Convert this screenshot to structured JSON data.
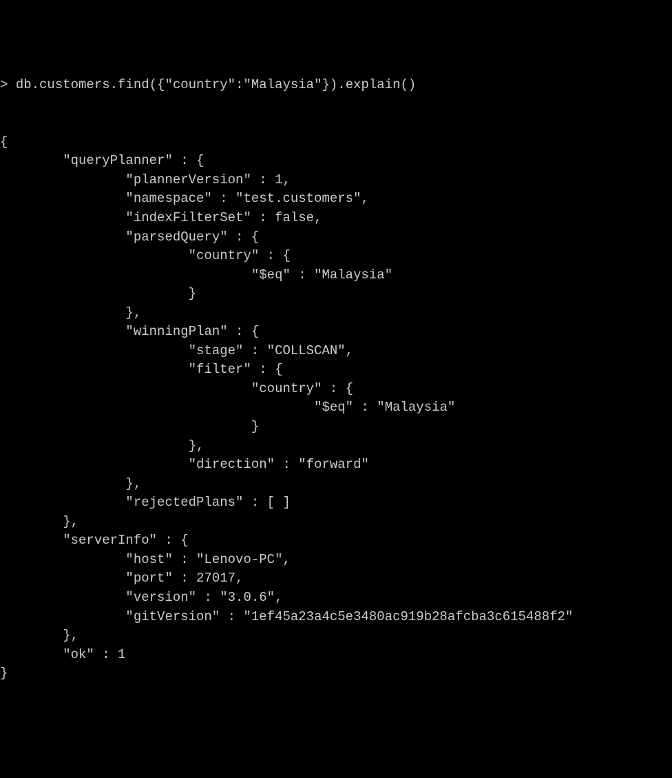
{
  "prompt": {
    "symbol": ">",
    "command": "db.customers.find({\"country\":\"Malaysia\"}).explain()"
  },
  "output": {
    "open_brace": "{",
    "qp_line": "        \"queryPlanner\" : {",
    "qp_plannerVersion": "                \"plannerVersion\" : 1,",
    "qp_namespace": "                \"namespace\" : \"test.customers\",",
    "qp_indexFilterSet": "                \"indexFilterSet\" : false,",
    "qp_parsedQuery": "                \"parsedQuery\" : {",
    "qp_pq_country": "                        \"country\" : {",
    "qp_pq_eq": "                                \"$eq\" : \"Malaysia\"",
    "qp_pq_close1": "                        }",
    "qp_pq_close2": "                },",
    "qp_winningPlan": "                \"winningPlan\" : {",
    "qp_wp_stage": "                        \"stage\" : \"COLLSCAN\",",
    "qp_wp_filter": "                        \"filter\" : {",
    "qp_wp_country": "                                \"country\" : {",
    "qp_wp_eq": "                                        \"$eq\" : \"Malaysia\"",
    "qp_wp_close1": "                                }",
    "qp_wp_close2": "                        },",
    "qp_wp_direction": "                        \"direction\" : \"forward\"",
    "qp_wp_close3": "                },",
    "qp_rejectedPlans": "                \"rejectedPlans\" : [ ]",
    "qp_close": "        },",
    "si_line": "        \"serverInfo\" : {",
    "si_host": "                \"host\" : \"Lenovo-PC\",",
    "si_port": "                \"port\" : 27017,",
    "si_version": "                \"version\" : \"3.0.6\",",
    "si_gitVersion": "                \"gitVersion\" : \"1ef45a23a4c5e3480ac919b28afcba3c615488f2\"",
    "si_close": "        },",
    "ok_line": "        \"ok\" : 1",
    "close_brace": "}"
  }
}
